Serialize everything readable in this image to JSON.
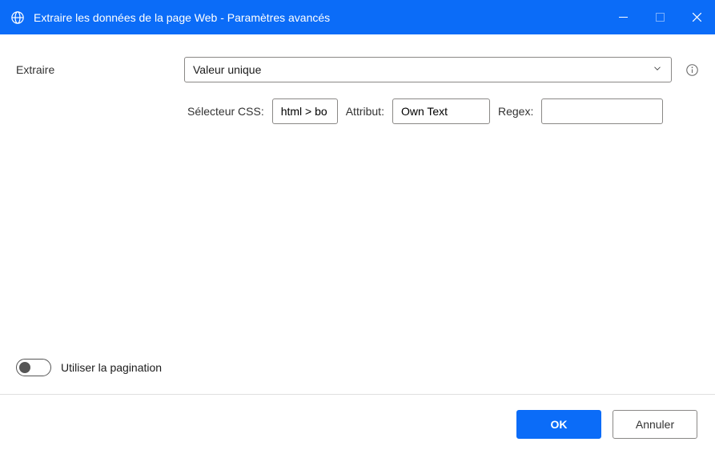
{
  "window": {
    "title": "Extraire les données de la page Web - Paramètres avancés"
  },
  "form": {
    "extract_label": "Extraire",
    "extract_value": "Valeur unique",
    "selector_label": "Sélecteur CSS:",
    "selector_value": "html > bo",
    "attribute_label": "Attribut:",
    "attribute_value": "Own Text",
    "regex_label": "Regex:",
    "regex_value": "",
    "pagination_label": "Utiliser la pagination"
  },
  "footer": {
    "ok": "OK",
    "cancel": "Annuler"
  }
}
